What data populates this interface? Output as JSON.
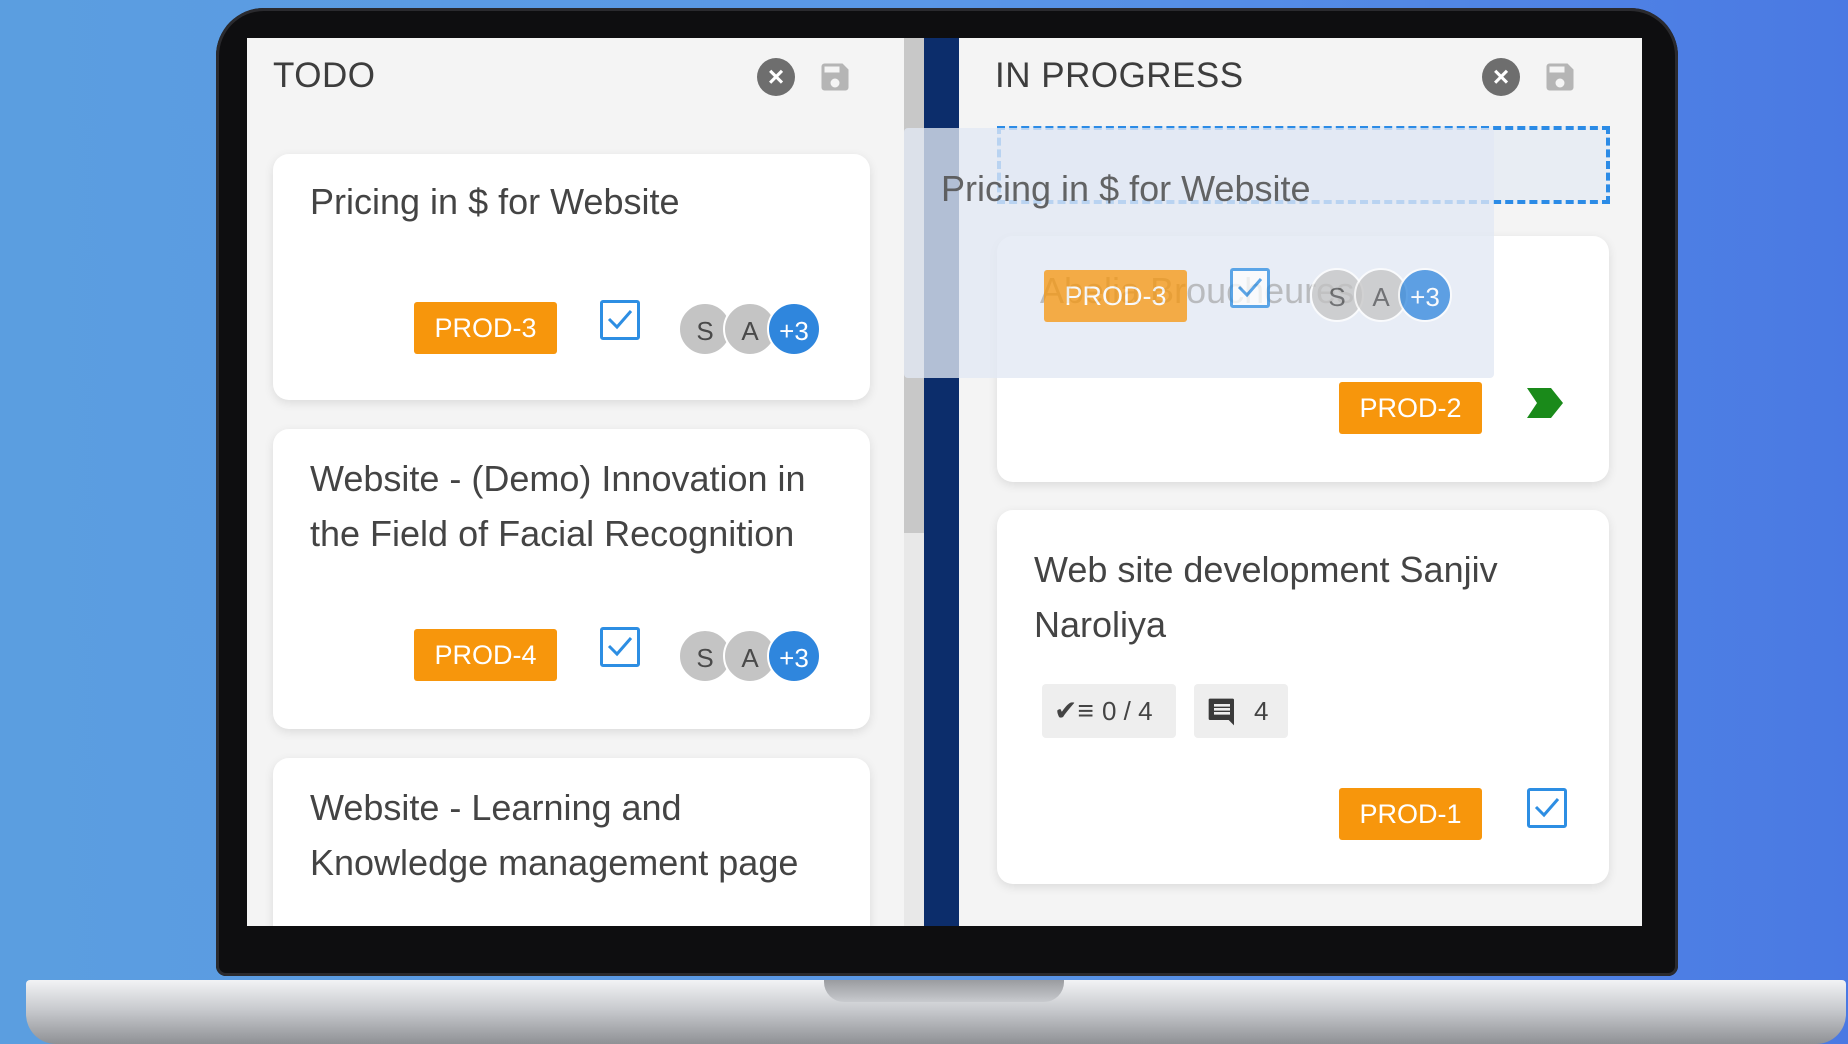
{
  "colors": {
    "accent_badge": "#f7960c",
    "checkbox": "#2d8ee3",
    "avatar_more": "#2f86dd",
    "divider": "#0c2d6b",
    "flag": "#1a8a1a"
  },
  "todo": {
    "title": "TODO",
    "cards": [
      {
        "title": "Pricing in $ for Website",
        "badge": "PROD-3",
        "avatars": [
          "S",
          "A"
        ],
        "more": "+3"
      },
      {
        "title": "Website - (Demo) Innovation in the Field of Facial Recognition",
        "badge": "PROD-4",
        "avatars": [
          "S",
          "A"
        ],
        "more": "+3"
      },
      {
        "title": "Website - Learning and Knowledge management page"
      }
    ]
  },
  "progress": {
    "title": "IN PROGRESS",
    "cards": [
      {
        "badge": "PROD-2",
        "icon": "flag-icon"
      },
      {
        "title": "Web site development Sanjiv Naroliya",
        "checklist": "0 / 4",
        "comments": "4",
        "badge": "PROD-1"
      }
    ]
  },
  "ghost": {
    "title": "Pricing in $ for Website",
    "subtitle": "Abelia Broucheures",
    "badge": "PROD-3",
    "avatars": [
      "S",
      "A"
    ],
    "more": "+3"
  }
}
